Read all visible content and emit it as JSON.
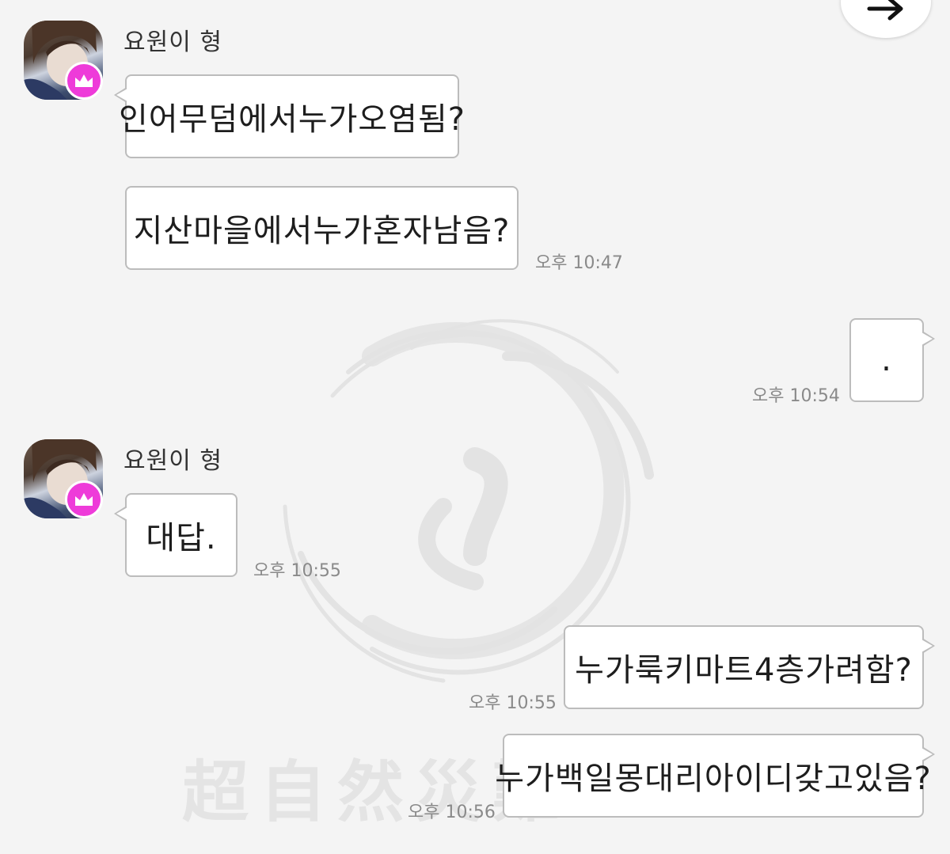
{
  "theme": {
    "background": "#f4f4f4",
    "bubble": "#ffffff",
    "bubble_border": "#bcbcbc",
    "badge": "#ee3bd9",
    "timestamp_color": "#8a8a8a"
  },
  "watermark": {
    "text": "超自然災難"
  },
  "top_button": {
    "icon": "arrow-right-icon"
  },
  "messages": [
    {
      "sender": "요원이 형",
      "badge_icon": "crown-icon",
      "text": "인어무덤에서누가오염됨?"
    },
    {
      "text": "지산마을에서누가혼자남음?",
      "time": "오후 10:47"
    },
    {
      "text": ".",
      "time": "오후 10:54"
    },
    {
      "sender": "요원이 형",
      "badge_icon": "crown-icon",
      "text": "대답.",
      "time": "오후 10:55"
    },
    {
      "text": "누가룩키마트4층가려함?",
      "time": "오후 10:55"
    },
    {
      "text": "누가백일몽대리아이디갖고있음?",
      "time": "오후 10:56"
    }
  ]
}
